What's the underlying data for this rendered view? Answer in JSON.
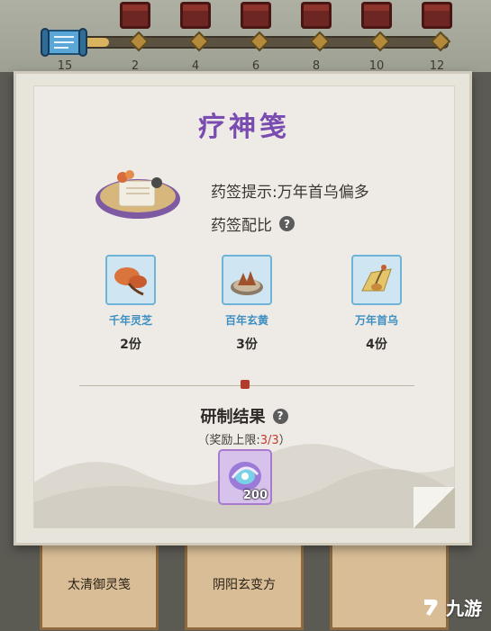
{
  "progress": {
    "fill_fraction": 0.08,
    "tick_labels": [
      "15",
      "2",
      "4",
      "6",
      "8",
      "10",
      "12"
    ]
  },
  "modal": {
    "title": "疗神笺",
    "hint_text": "药签提示:万年首乌偏多",
    "ratio_label": "药签配比",
    "help_glyph": "?",
    "herbs": [
      {
        "name": "千年灵芝",
        "qty": "2份"
      },
      {
        "name": "百年玄黄",
        "qty": "3份"
      },
      {
        "name": "万年首乌",
        "qty": "4份"
      }
    ],
    "result_title": "研制结果",
    "reward_cap_prefix": "（奖励上限:",
    "reward_cap_value": "3/3",
    "reward_cap_suffix": "）",
    "reward_count": "200"
  },
  "recipes": [
    {
      "label": "太清御灵笺"
    },
    {
      "label": "阴阳玄变方"
    }
  ],
  "watermark": {
    "text": "九游"
  },
  "colors": {
    "title_purple": "#7a4bb0",
    "herb_name_blue": "#3d8fc1",
    "cap_red": "#c33a2c"
  },
  "icons": {
    "scroll": "scroll-icon",
    "help": "help-icon",
    "reward": "spirit-orb-icon"
  }
}
